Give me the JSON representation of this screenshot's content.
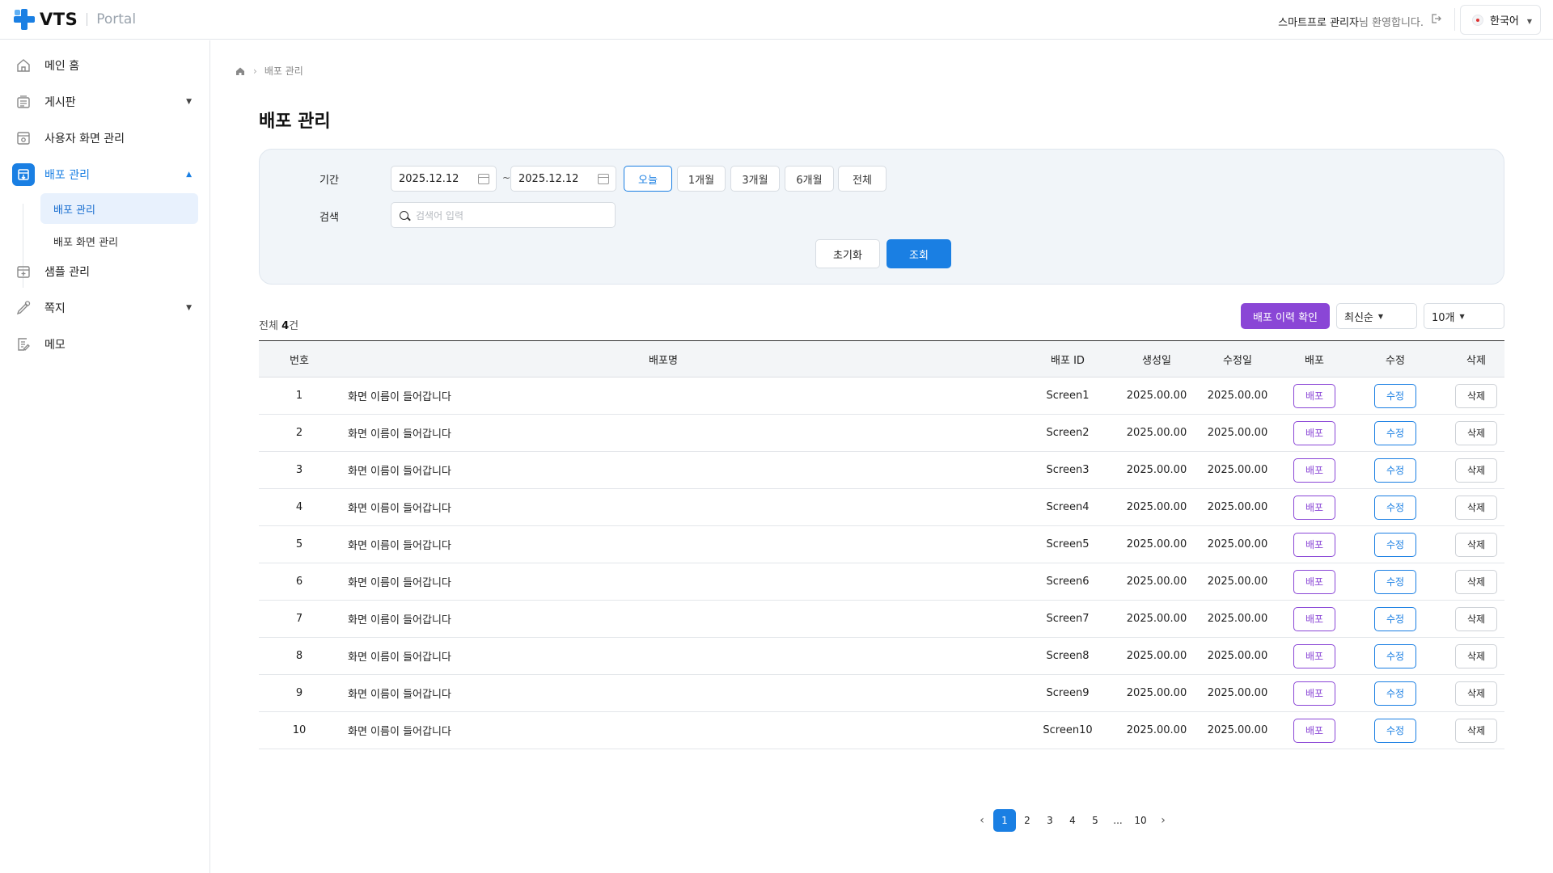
{
  "app": {
    "logo": "VTS",
    "product": "Portal"
  },
  "header": {
    "user_name": "스마트프로 관리자",
    "welcome_suffix": "님 환영합니다.",
    "language": "한국어"
  },
  "sidebar": {
    "items": [
      {
        "label": "메인 홈",
        "icon": "home-icon"
      },
      {
        "label": "게시판",
        "icon": "board-icon",
        "caret": "down"
      },
      {
        "label": "사용자 화면 관리",
        "icon": "screen-icon"
      },
      {
        "label": "배포 관리",
        "icon": "deploy-icon",
        "caret": "up",
        "active": true
      },
      {
        "label": "샘플 관리",
        "icon": "sample-icon"
      },
      {
        "label": "쪽지",
        "icon": "message-icon",
        "caret": "down"
      },
      {
        "label": "메모",
        "icon": "memo-icon"
      }
    ],
    "subitems": [
      {
        "label": "배포 관리",
        "active": true
      },
      {
        "label": "배포 화면 관리"
      }
    ]
  },
  "breadcrumb": {
    "current": "배포 관리"
  },
  "page": {
    "title": "배포 관리"
  },
  "filter": {
    "period_label": "기간",
    "search_label": "검색",
    "date_from": "2025.12.12",
    "date_to": "2025.12.12",
    "tilde": "~",
    "periods": [
      "오늘",
      "1개월",
      "3개월",
      "6개월",
      "전체"
    ],
    "selected_period": "오늘",
    "search_placeholder": "검색어 입력",
    "reset": "초기화",
    "query": "조회"
  },
  "list": {
    "total_prefix": "전체",
    "total_count": "4",
    "total_suffix": "건",
    "history_button": "배포 이력 확인",
    "sort": "최신순",
    "page_size": "10개"
  },
  "table": {
    "columns": [
      "번호",
      "배포명",
      "배포 ID",
      "생성일",
      "수정일",
      "배포",
      "수정",
      "삭제"
    ],
    "action_labels": {
      "deploy": "배포",
      "edit": "수정",
      "delete": "삭제"
    },
    "rows": [
      {
        "no": "1",
        "name": "화면 이름이 들어갑니다",
        "id": "Screen1",
        "created": "2025.00.00",
        "modified": "2025.00.00"
      },
      {
        "no": "2",
        "name": "화면 이름이 들어갑니다",
        "id": "Screen2",
        "created": "2025.00.00",
        "modified": "2025.00.00"
      },
      {
        "no": "3",
        "name": "화면 이름이 들어갑니다",
        "id": "Screen3",
        "created": "2025.00.00",
        "modified": "2025.00.00"
      },
      {
        "no": "4",
        "name": "화면 이름이 들어갑니다",
        "id": "Screen4",
        "created": "2025.00.00",
        "modified": "2025.00.00"
      },
      {
        "no": "5",
        "name": "화면 이름이 들어갑니다",
        "id": "Screen5",
        "created": "2025.00.00",
        "modified": "2025.00.00"
      },
      {
        "no": "6",
        "name": "화면 이름이 들어갑니다",
        "id": "Screen6",
        "created": "2025.00.00",
        "modified": "2025.00.00"
      },
      {
        "no": "7",
        "name": "화면 이름이 들어갑니다",
        "id": "Screen7",
        "created": "2025.00.00",
        "modified": "2025.00.00"
      },
      {
        "no": "8",
        "name": "화면 이름이 들어갑니다",
        "id": "Screen8",
        "created": "2025.00.00",
        "modified": "2025.00.00"
      },
      {
        "no": "9",
        "name": "화면 이름이 들어갑니다",
        "id": "Screen9",
        "created": "2025.00.00",
        "modified": "2025.00.00"
      },
      {
        "no": "10",
        "name": "화면 이름이 들어갑니다",
        "id": "Screen10",
        "created": "2025.00.00",
        "modified": "2025.00.00"
      }
    ]
  },
  "pagination": {
    "pages": [
      "1",
      "2",
      "3",
      "4",
      "5",
      "...",
      "10"
    ],
    "current": "1",
    "prev": "‹",
    "next": "›"
  },
  "colors": {
    "primary": "#1a7fe3",
    "purple": "#8a46d6"
  }
}
